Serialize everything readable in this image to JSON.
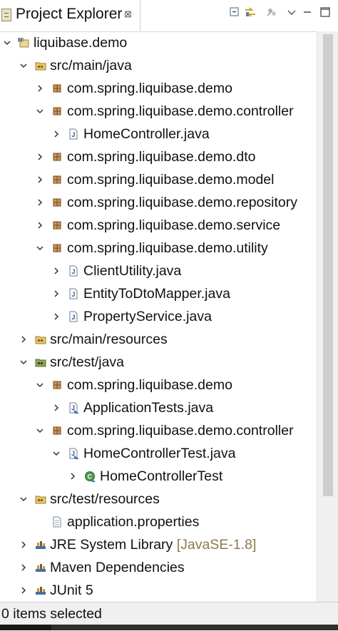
{
  "view": {
    "title": "Project Explorer",
    "close_glyph": "⊠",
    "toolbar": [
      "collapse-all-icon",
      "link-with-editor-icon",
      "filters-icon",
      "view-menu-icon",
      "minimize-icon",
      "maximize-icon"
    ]
  },
  "tree": [
    {
      "label": "liquibase.demo",
      "icon": "project-icon",
      "expanded": true
    },
    {
      "label": "src/main/java",
      "icon": "source-folder-icon",
      "expanded": true
    },
    {
      "label": "com.spring.liquibase.demo",
      "icon": "package-icon",
      "expanded": false
    },
    {
      "label": "com.spring.liquibase.demo.controller",
      "icon": "package-icon",
      "expanded": true
    },
    {
      "label": "HomeController.java",
      "icon": "java-file-icon",
      "expanded": false
    },
    {
      "label": "com.spring.liquibase.demo.dto",
      "icon": "package-icon",
      "expanded": false
    },
    {
      "label": "com.spring.liquibase.demo.model",
      "icon": "package-icon",
      "expanded": false
    },
    {
      "label": "com.spring.liquibase.demo.repository",
      "icon": "package-icon",
      "expanded": false
    },
    {
      "label": "com.spring.liquibase.demo.service",
      "icon": "package-icon",
      "expanded": false
    },
    {
      "label": "com.spring.liquibase.demo.utility",
      "icon": "package-icon",
      "expanded": true
    },
    {
      "label": "ClientUtility.java",
      "icon": "java-file-icon",
      "expanded": false
    },
    {
      "label": "EntityToDtoMapper.java",
      "icon": "java-file-icon",
      "expanded": false
    },
    {
      "label": "PropertyService.java",
      "icon": "java-file-icon",
      "expanded": false
    },
    {
      "label": "src/main/resources",
      "icon": "source-folder-icon",
      "expanded": false
    },
    {
      "label": "src/test/java",
      "icon": "source-folder-icon",
      "expanded": true
    },
    {
      "label": "com.spring.liquibase.demo",
      "icon": "package-icon",
      "expanded": true
    },
    {
      "label": "ApplicationTests.java",
      "icon": "java-test-file-icon",
      "expanded": false
    },
    {
      "label": "com.spring.liquibase.demo.controller",
      "icon": "package-icon",
      "expanded": true
    },
    {
      "label": "HomeControllerTest.java",
      "icon": "java-test-file-icon",
      "expanded": true
    },
    {
      "label": "HomeControllerTest",
      "icon": "class-icon",
      "expanded": false
    },
    {
      "label": "src/test/resources",
      "icon": "source-folder-icon",
      "expanded": true
    },
    {
      "label": "application.properties",
      "icon": "properties-file-icon",
      "expanded": false
    },
    {
      "label": "JRE System Library",
      "decoration": "[JavaSE-1.8]",
      "icon": "library-icon",
      "expanded": false
    },
    {
      "label": "Maven Dependencies",
      "icon": "library-icon",
      "expanded": false
    },
    {
      "label": "JUnit 5",
      "icon": "library-icon",
      "expanded": false
    }
  ],
  "status": {
    "text": "0 items selected"
  }
}
